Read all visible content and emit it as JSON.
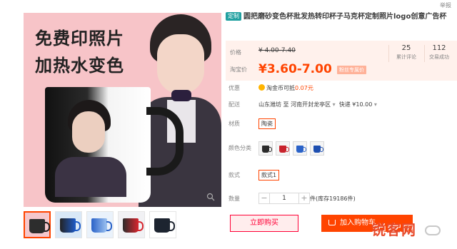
{
  "header": {
    "report_link": "举报"
  },
  "gallery": {
    "promo_line1": "免费印照片",
    "promo_line2": "加热水变色",
    "zoom_icon": "search-icon",
    "thumbnails": [
      {
        "name": "thumb-black-mug",
        "selected": true
      },
      {
        "name": "thumb-blue-inner-mug"
      },
      {
        "name": "thumb-light-blue-mug"
      },
      {
        "name": "thumb-red-mug"
      },
      {
        "name": "thumb-dark-mug"
      }
    ]
  },
  "product": {
    "tag": "定制",
    "title": "圆把磨砂变色杯批发热转印杯子马克杯定制照片logo创意广告杯"
  },
  "price": {
    "label": "价格",
    "original": "¥ 4.00-7.40",
    "promo_label": "淘宝价",
    "current": "¥3.60-7.00",
    "member_badge": "粉丝专属价",
    "stats": [
      {
        "num": "25",
        "caption": "累计评论"
      },
      {
        "num": "112",
        "caption": "交易成功"
      }
    ]
  },
  "offer": {
    "label": "优惠",
    "coin_text": "淘金币可抵",
    "coin_amount": "0.07元"
  },
  "delivery": {
    "label": "配送",
    "from": "山东潍坊 至",
    "to": "河南开封龙亭区",
    "method": "快递 ¥10.00"
  },
  "material": {
    "label": "材质",
    "value": "陶瓷"
  },
  "color": {
    "label": "颜色分类",
    "swatches": [
      "black",
      "red",
      "blue",
      "dark-blue"
    ]
  },
  "style": {
    "label": "款式",
    "value": "款式1"
  },
  "quantity": {
    "label": "数量",
    "minus": "−",
    "value": "1",
    "plus": "+",
    "stock": "件(库存19186件)"
  },
  "actions": {
    "buy_now": "立即购买",
    "add_to_cart": "加入购物车"
  },
  "watermark": {
    "text": "锐客网"
  },
  "colors": {
    "accent": "#ff4400",
    "buy_red": "#ff0036",
    "price_bg": "#fff1ec",
    "tag_teal": "#21a0a0"
  }
}
